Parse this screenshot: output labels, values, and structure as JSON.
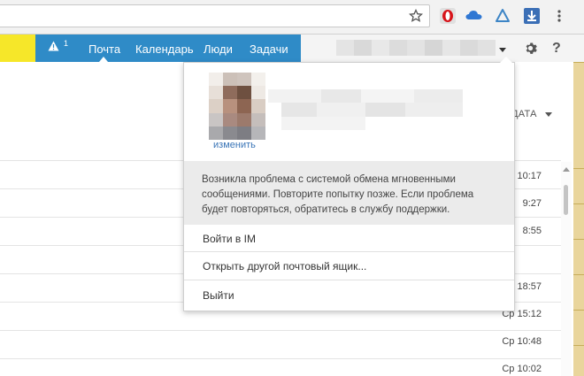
{
  "nav": {
    "alert_count": "1",
    "tabs": [
      {
        "label": "Почта"
      },
      {
        "label": "Календарь"
      },
      {
        "label": "Люди"
      },
      {
        "label": "Задачи"
      }
    ],
    "settings_icon": "gear-icon",
    "help_label": "?"
  },
  "list": {
    "sort_label": "ДАТА",
    "times": [
      "10:17",
      "9:27",
      "8:55",
      "18:57",
      "Ср 15:12",
      "Ср 10:48",
      "Ср 10:02"
    ]
  },
  "panel": {
    "change_photo": "изменить",
    "error_message": "Возникла проблема с системой обмена мгновенными сообщениями. Повторите попытку позже. Если проблема будет повторяться, обратитесь в службу поддержки.",
    "menu": [
      {
        "label": "Войти в IM"
      },
      {
        "label": "Открыть другой почтовый ящик..."
      },
      {
        "label": "Выйти"
      }
    ]
  },
  "colors": {
    "nav_blue": "#2f8bc7",
    "nav_yellow": "#f6e729",
    "link_blue": "#3a75b7"
  }
}
